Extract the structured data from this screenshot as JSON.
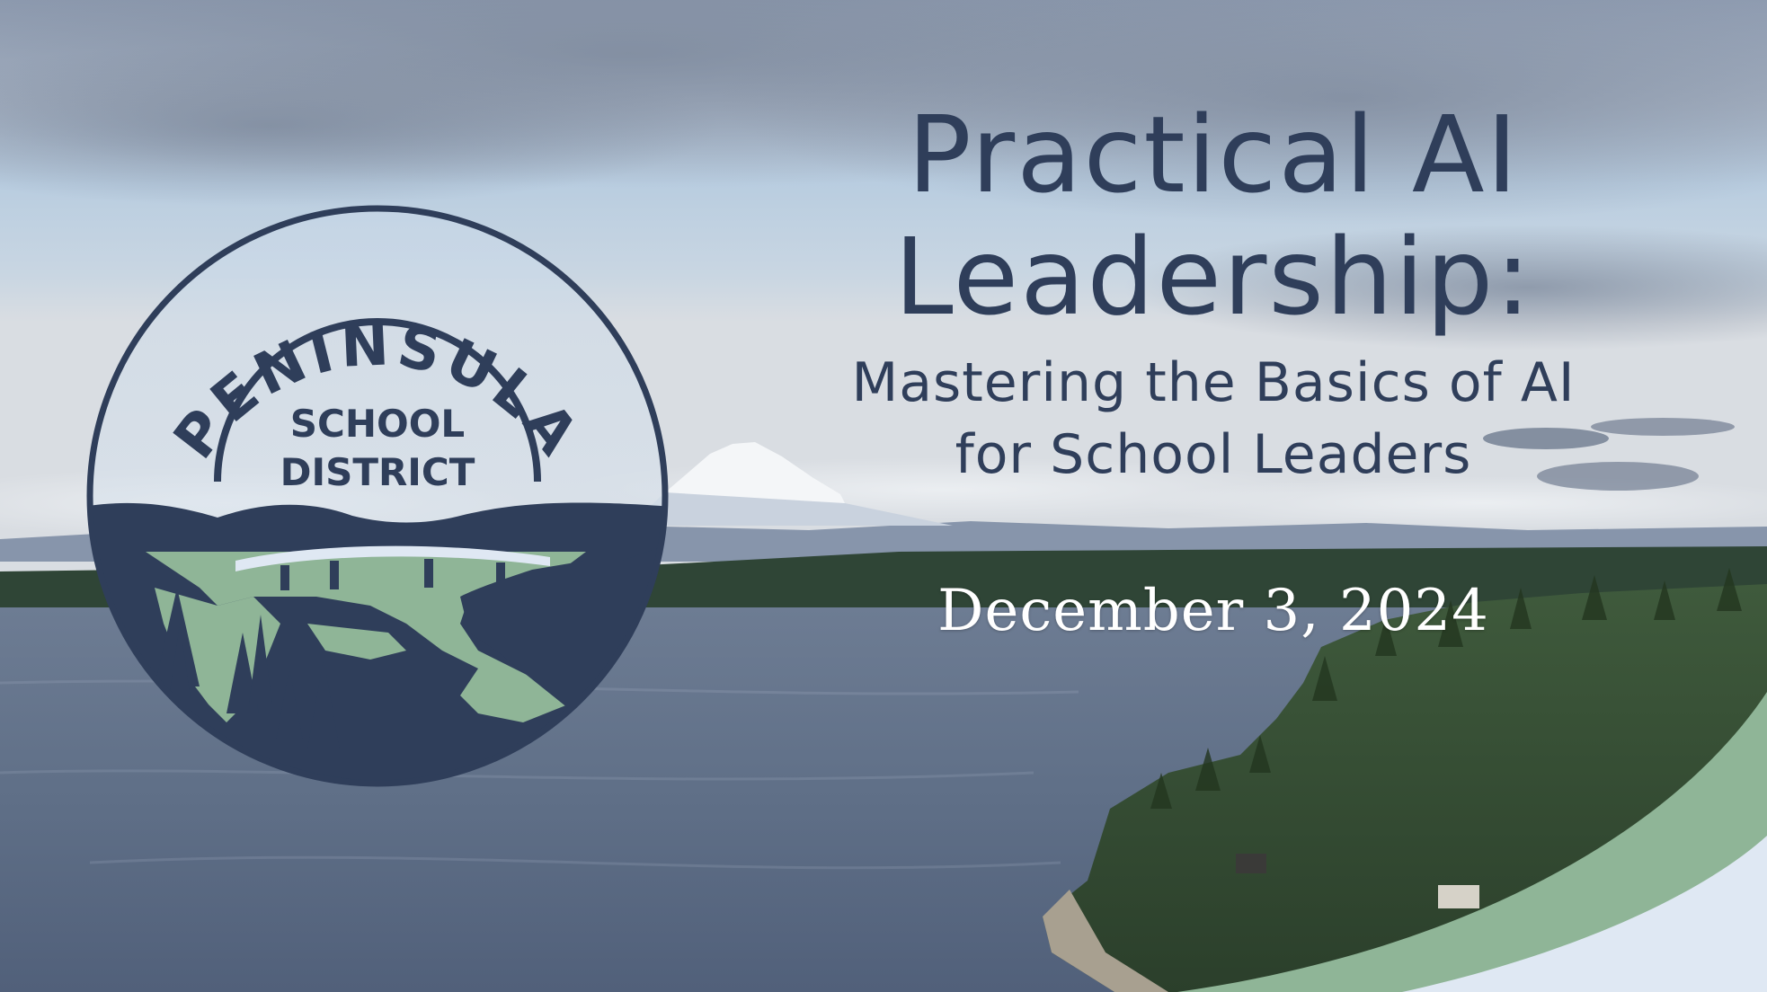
{
  "slide": {
    "title_line_1": "Practical AI",
    "title_line_2": "Leadership:",
    "subtitle_line_1": "Mastering the Basics of AI",
    "subtitle_line_2": "for School Leaders",
    "date": "December 3, 2024"
  },
  "logo": {
    "arc_text": "PENINSULA",
    "line_1": "SCHOOL",
    "line_2": "DISTRICT"
  },
  "colors": {
    "navy": "#2f3e5a",
    "green": "#8fb597",
    "pale_blue": "#dfe8f3",
    "white": "#ffffff"
  }
}
